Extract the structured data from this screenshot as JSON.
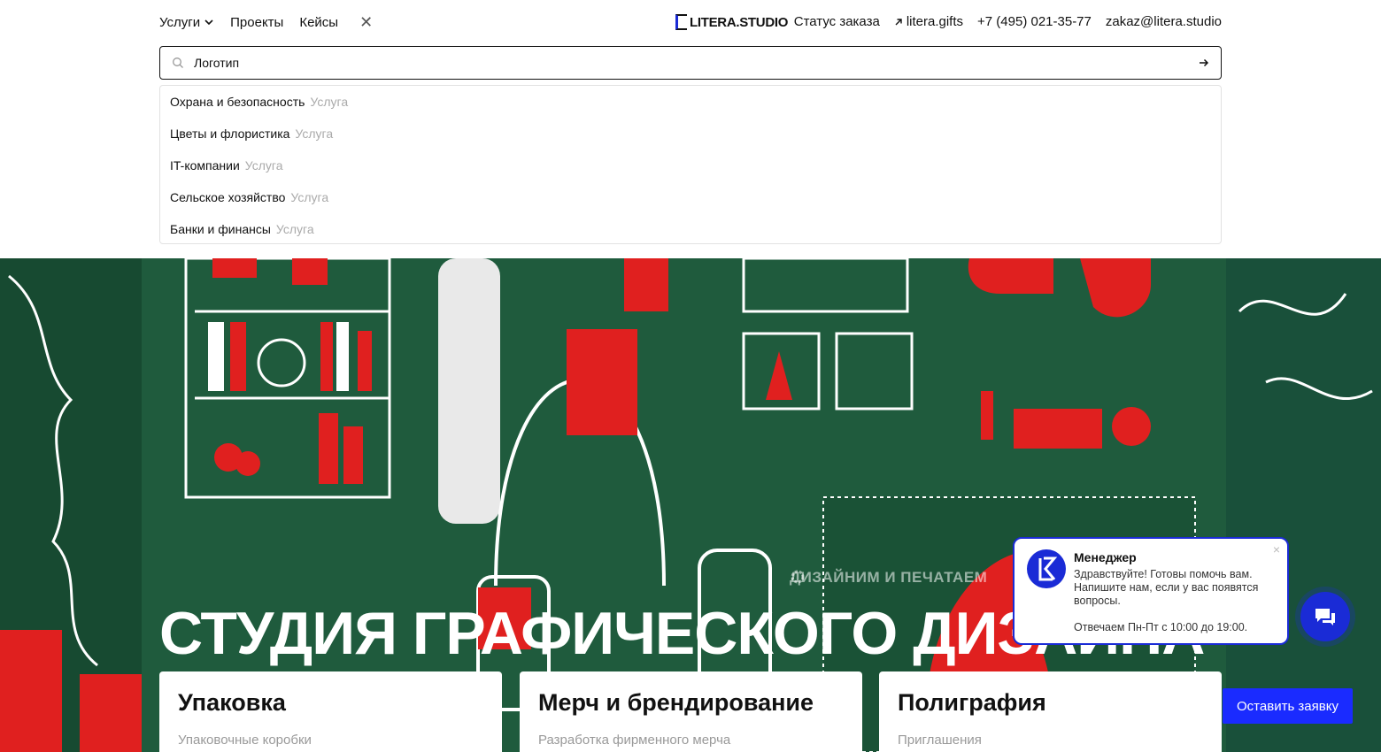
{
  "nav": {
    "services": "Услуги",
    "projects": "Проекты",
    "cases": "Кейсы",
    "close": "✕"
  },
  "logo": {
    "text": "LITERA.STUDIO"
  },
  "topbar": {
    "order_status": "Статус заказа",
    "gifts": "litera.gifts",
    "phone": "+7 (495) 021-35-77",
    "email": "zakaz@litera.studio"
  },
  "search": {
    "value": "Логотип"
  },
  "suggestions": [
    {
      "label": "Охрана и безопасность",
      "kind": "Услуга"
    },
    {
      "label": "Цветы и флористика",
      "kind": "Услуга"
    },
    {
      "label": "IT-компании",
      "kind": "Услуга"
    },
    {
      "label": "Сельское хозяйство",
      "kind": "Услуга"
    },
    {
      "label": "Банки и финансы",
      "kind": "Услуга"
    }
  ],
  "hero": {
    "subtitle": "ДИЗАЙНИМ И ПЕЧАТАЕМ",
    "title": "СТУДИЯ ГРАФИЧЕСКОГО ДИЗАЙНА",
    "cta": "Оставить заявку"
  },
  "cards": [
    {
      "title": "Упаковка",
      "sub": "Упаковочные коробки"
    },
    {
      "title": "Мерч и брендирование",
      "sub": "Разработка фирменного мерча"
    },
    {
      "title": "Полиграфия",
      "sub": "Приглашения"
    }
  ],
  "chat": {
    "name": "Менеджер",
    "message": "Здравствуйте! Готовы помочь вам. Напишите нам, если у вас появятся вопросы.",
    "hours": "Отвечаем Пн-Пт с 10:00 до 19:00.",
    "close": "×"
  },
  "colors": {
    "accent": "#1a2bff",
    "hero_bg": "#1e5a3c",
    "hero_red": "#e0201f"
  }
}
